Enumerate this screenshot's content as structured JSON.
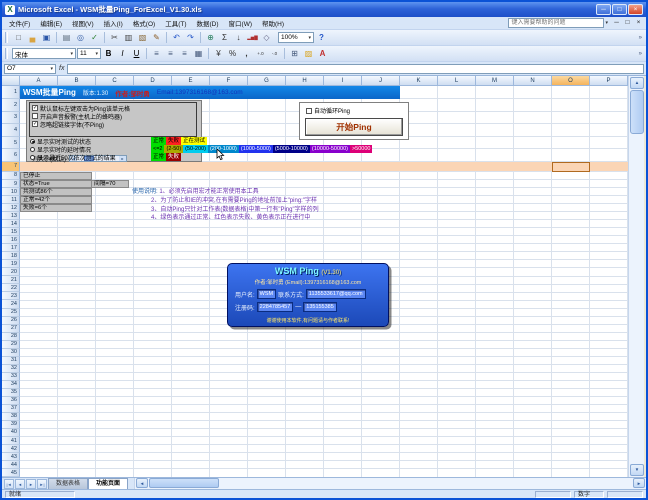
{
  "window": {
    "title": "Microsoft Excel - WSM批量Ping_ForExcel_V1.30.xls",
    "help_placeholder": "键入需要帮助的问题"
  },
  "window_buttons": [
    {
      "name": "minimize-button",
      "glyph": "─"
    },
    {
      "name": "restore-button",
      "glyph": "□"
    },
    {
      "name": "close-button",
      "glyph": "×"
    }
  ],
  "workbook_buttons": [
    {
      "name": "workbook-minimize-button",
      "glyph": "─"
    },
    {
      "name": "workbook-restore-button",
      "glyph": "□"
    },
    {
      "name": "workbook-close-button",
      "glyph": "×"
    }
  ],
  "menus": [
    "文件(F)",
    "编辑(E)",
    "视图(V)",
    "插入(I)",
    "格式(O)",
    "工具(T)",
    "数据(D)",
    "窗口(W)",
    "帮助(H)"
  ],
  "glyphs": {
    "dropdown": "▾",
    "check": "✓",
    "scroll_up": "▲",
    "scroll_down": "▼",
    "scroll_left": "◄",
    "scroll_right": "►",
    "fx": "fx",
    "chevron": "»"
  },
  "toolbar": {
    "zoom": "100%",
    "font": "宋体",
    "size": "11"
  },
  "icons_standard": [
    {
      "name": "new-icon",
      "glyph": "□",
      "color": "#555555"
    },
    {
      "name": "open-icon",
      "glyph": "▄",
      "color": "#D9A441"
    },
    {
      "name": "save-icon",
      "glyph": "▣",
      "color": "#2A56A8"
    },
    {
      "sep": true
    },
    {
      "name": "print-icon",
      "glyph": "▤",
      "color": "#5A6A7A"
    },
    {
      "name": "print-preview-icon",
      "glyph": "◎",
      "color": "#3A62A8"
    },
    {
      "name": "spelling-icon",
      "glyph": "✓",
      "color": "#2A7F2A"
    },
    {
      "sep": true
    },
    {
      "name": "cut-icon",
      "glyph": "✂",
      "color": "#444444"
    },
    {
      "name": "copy-icon",
      "glyph": "▥",
      "color": "#444444"
    },
    {
      "name": "paste-icon",
      "glyph": "▧",
      "color": "#8A6A3A"
    },
    {
      "name": "format-painter-icon",
      "glyph": "✎",
      "color": "#8A5A20"
    },
    {
      "sep": true
    },
    {
      "name": "undo-icon",
      "glyph": "↶",
      "color": "#2456C8"
    },
    {
      "name": "redo-icon",
      "glyph": "↷",
      "color": "#2456C8"
    },
    {
      "sep": true
    },
    {
      "name": "hyperlink-icon",
      "glyph": "⊕",
      "color": "#2A7F5F"
    },
    {
      "name": "autosum-icon",
      "glyph": "Σ",
      "color": "#333333"
    },
    {
      "name": "sort-ascending-icon",
      "glyph": "↓",
      "color": "#333333"
    },
    {
      "name": "chart-wizard-icon",
      "glyph": "▂▅▇",
      "color": "#B03030",
      "size": 4.5
    },
    {
      "name": "drawing-icon",
      "glyph": "◇",
      "color": "#6A6A8A"
    }
  ],
  "icons_standard_right": [
    {
      "name": "help-icon",
      "glyph": "?",
      "color": "#2456C8",
      "bold": true
    }
  ],
  "icons_formatting": [
    {
      "name": "bold-icon",
      "glyph": "B",
      "color": "#000000",
      "bold": true
    },
    {
      "name": "italic-icon",
      "glyph": "I",
      "color": "#000000",
      "italic": true
    },
    {
      "name": "underline-icon",
      "glyph": "U",
      "color": "#000000",
      "underline": true
    },
    {
      "sep": true
    },
    {
      "name": "align-left-icon",
      "glyph": "≡",
      "color": "#44587A"
    },
    {
      "name": "align-center-icon",
      "glyph": "≡",
      "color": "#44587A"
    },
    {
      "name": "align-right-icon",
      "glyph": "≡",
      "color": "#44587A"
    },
    {
      "name": "merge-center-icon",
      "glyph": "▦",
      "color": "#44587A"
    },
    {
      "sep": true
    },
    {
      "name": "currency-icon",
      "glyph": "¥",
      "color": "#333333"
    },
    {
      "name": "percent-icon",
      "glyph": "%",
      "color": "#333333"
    },
    {
      "name": "comma-style-icon",
      "glyph": ",",
      "color": "#333333",
      "bold": true
    },
    {
      "name": "increase-decimal-icon",
      "glyph": "+.0",
      "color": "#333333",
      "size": 4.5
    },
    {
      "name": "decrease-decimal-icon",
      "glyph": "-.0",
      "color": "#333333",
      "size": 4.5
    },
    {
      "sep": true
    },
    {
      "name": "borders-icon",
      "glyph": "⊞",
      "color": "#44587A"
    },
    {
      "name": "fill-color-icon",
      "glyph": "▨",
      "color": "#D9A520"
    },
    {
      "name": "font-color-icon",
      "glyph": "A",
      "color": "#C03030",
      "bold": true
    }
  ],
  "formula_bar": {
    "name_box": "O7"
  },
  "grid": {
    "columns": [
      "A",
      "B",
      "C",
      "D",
      "E",
      "F",
      "G",
      "H",
      "I",
      "J",
      "K",
      "L",
      "M",
      "N",
      "O",
      "P"
    ],
    "rows": 45,
    "selected_column": "O",
    "selected_row": 7
  },
  "banner": {
    "title": "WSM批量Ping",
    "version": "版本:1.30",
    "author": "作者:邹时勇",
    "email": "Email:1397316168@163.com"
  },
  "panel": {
    "checkboxes": [
      {
        "label": "默认鼠标左键双击为Ping该单元格",
        "checked": true
      },
      {
        "label": "开启声音报警(主机上的蜂鸣器)",
        "checked": false
      },
      {
        "label": "忽略超链接字体(不Ping)",
        "checked": true
      }
    ],
    "size_label": "列大小(默认)",
    "radios": [
      {
        "label": "显示实时测试的状态",
        "selected": true,
        "legend": [
          {
            "text": "正常",
            "bg": "#00DD00",
            "fg": "#000000"
          },
          {
            "text": "失败",
            "bg": "#FF2020",
            "fg": "#000000"
          },
          {
            "text": "正在测试",
            "bg": "#FFFF00",
            "fg": "#000000"
          }
        ]
      },
      {
        "label": "显示实时的延时情况",
        "selected": false,
        "legend": [
          {
            "text": "<=2",
            "bg": "#00DD00",
            "fg": "#000000"
          },
          {
            "text": "(2-50)",
            "bg": "#AAAA00",
            "fg": "#000000"
          },
          {
            "text": "(50-200)",
            "bg": "#00CCEE",
            "fg": "#000000"
          },
          {
            "text": "(200-1000)",
            "bg": "#0088CC",
            "fg": "#ffffff"
          },
          {
            "text": "(1000-5000)",
            "bg": "#2233EE",
            "fg": "#ffffff"
          },
          {
            "text": "(5000-10000)",
            "bg": "#000088",
            "fg": "#ffffff"
          },
          {
            "text": "(10000-50000)",
            "bg": "#8800CC",
            "fg": "#ffffff"
          },
          {
            "text": ">50000",
            "bg": "#DD0077",
            "fg": "#ffffff"
          }
        ]
      },
      {
        "label": "显示最近50次依次测试的结果",
        "selected": false,
        "legend": [
          {
            "text": "正常",
            "bg": "#00DD00",
            "fg": "#000000"
          },
          {
            "text": "失败",
            "bg": "#990000",
            "fg": "#ffffff"
          }
        ]
      }
    ]
  },
  "controls": {
    "auto_loop_label": "自动循环Ping",
    "auto_loop_checked": false,
    "start_button": "开始Ping"
  },
  "stats": {
    "stopped": "已停止",
    "state": "状态=True",
    "interval": "间隔=70",
    "tested": "共测试86个",
    "ok": "正常=42个",
    "fail": "失败=6个"
  },
  "instructions": {
    "prefix": "使用说明:",
    "lines": [
      "1、必须先启用宏才能正常使用本工具",
      "2、为了防止和IE的冲突,在有需要Ping的地址前加上\"ping:\"字样",
      "3、自动Ping只针对工作表(数据表格)中第一行有\"Ping\"字样的列",
      "4、绿色表示通过正常、红色表示失败、黄色表示正在进行中"
    ]
  },
  "about": {
    "title": "WSM Ping",
    "version": "(V1.30)",
    "author_line": "作者:邹时勇 (Email):1397316168@163.com",
    "fields": {
      "user_label": "用户名:",
      "user_value": "WSM",
      "contact_label": "联系方式:",
      "contact_value": "1135533617@qq.com",
      "reg_label": "注册码:",
      "reg_value1": "2284785457",
      "dash": "—",
      "reg_value2": "135155385"
    },
    "footer": "谢谢使用本软件,有问题请与作者联系!"
  },
  "sheet_tabs": [
    {
      "label": "数据表格",
      "active": false
    },
    {
      "label": "功能页面",
      "active": true
    }
  ],
  "tab_nav": [
    {
      "name": "tab-scroll-first-button",
      "glyph": "|◄"
    },
    {
      "name": "tab-scroll-prev-button",
      "glyph": "◄"
    },
    {
      "name": "tab-scroll-next-button",
      "glyph": "►"
    },
    {
      "name": "tab-scroll-last-button",
      "glyph": "►|"
    }
  ],
  "status_bar": {
    "left": "就绪",
    "num": "数字"
  }
}
